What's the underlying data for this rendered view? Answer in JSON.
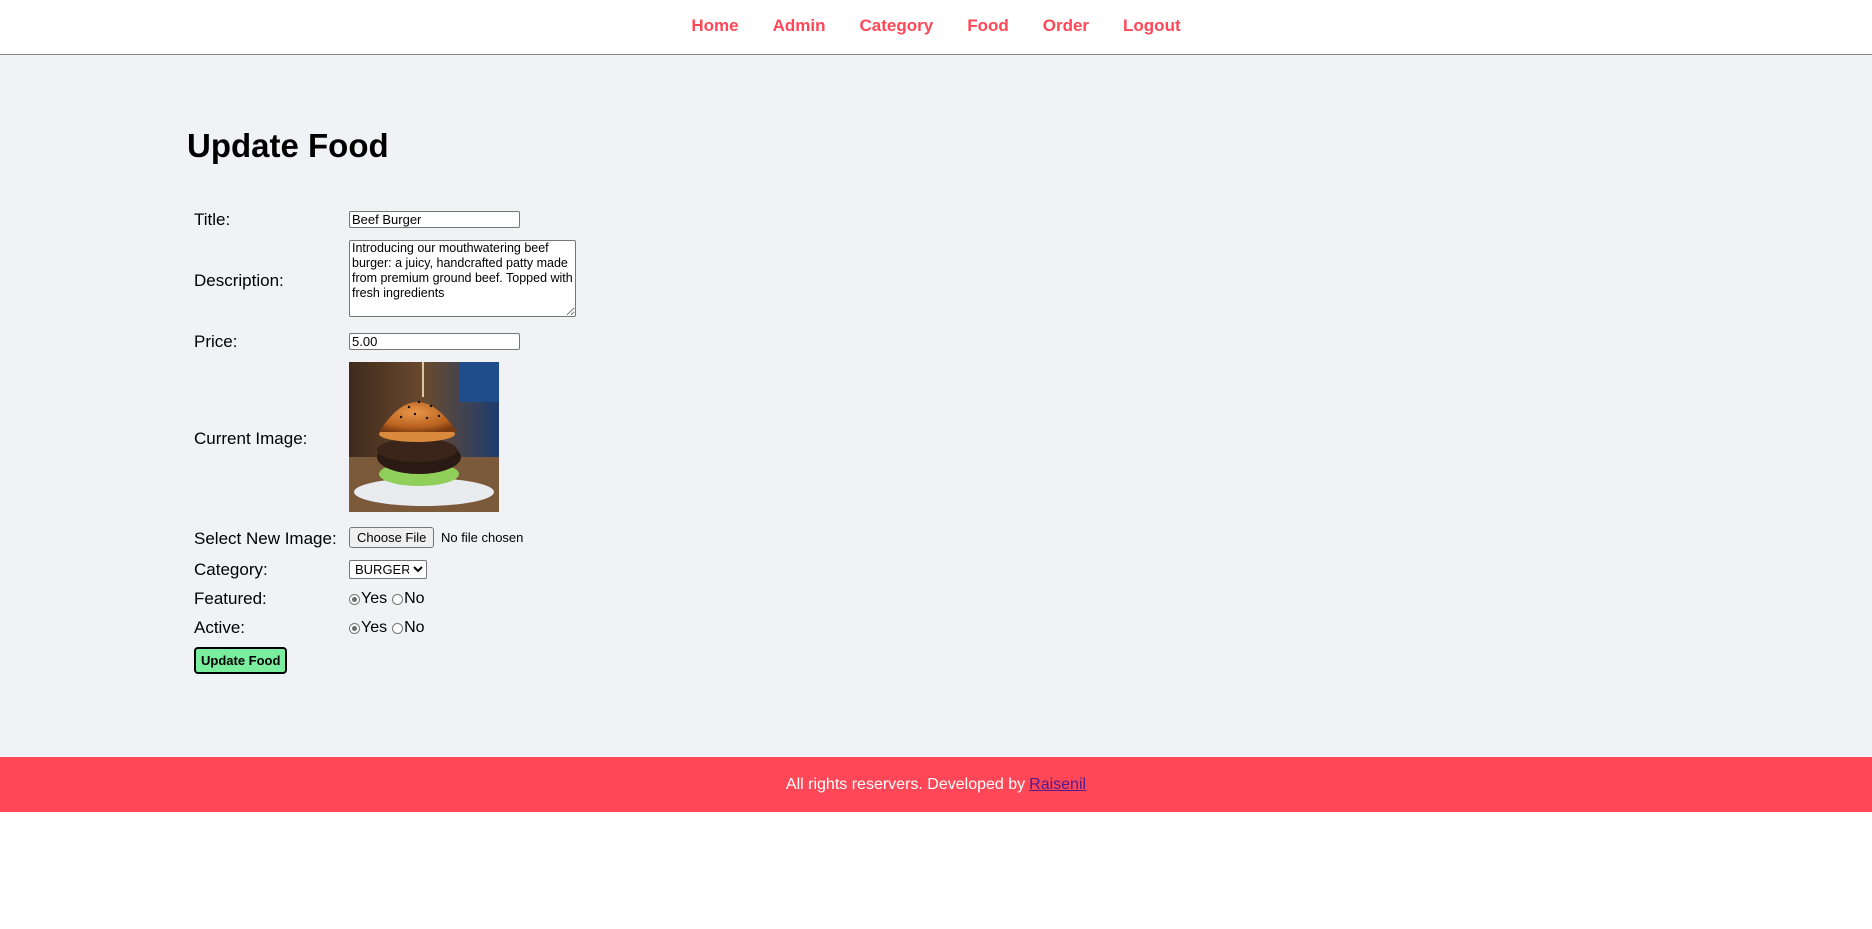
{
  "nav": {
    "items": [
      {
        "label": "Home"
      },
      {
        "label": "Admin"
      },
      {
        "label": "Category"
      },
      {
        "label": "Food"
      },
      {
        "label": "Order"
      },
      {
        "label": "Logout"
      }
    ],
    "color": "#ff4757"
  },
  "main": {
    "title": "Update Food",
    "form": {
      "title_label": "Title:",
      "title_value": "Beef Burger",
      "description_label": "Description:",
      "description_value": "Introducing our mouthwatering beef burger: a juicy, handcrafted patty made from premium ground beef. Topped with fresh ingredients",
      "price_label": "Price:",
      "price_value": "5.00",
      "current_image_label": "Current Image:",
      "select_image_label": "Select New Image:",
      "choose_file_button": "Choose File",
      "file_status": "No file chosen",
      "category_label": "Category:",
      "category_value": "BURGER",
      "featured_label": "Featured:",
      "featured_yes": "Yes",
      "featured_no": "No",
      "featured_selected": "Yes",
      "active_label": "Active:",
      "active_yes": "Yes",
      "active_no": "No",
      "active_selected": "Yes",
      "submit_label": "Update Food",
      "submit_color": "#7bed9f"
    }
  },
  "footer": {
    "text": "All rights reservers. Developed by",
    "link": "Raisenil",
    "color": "#ff4757"
  }
}
